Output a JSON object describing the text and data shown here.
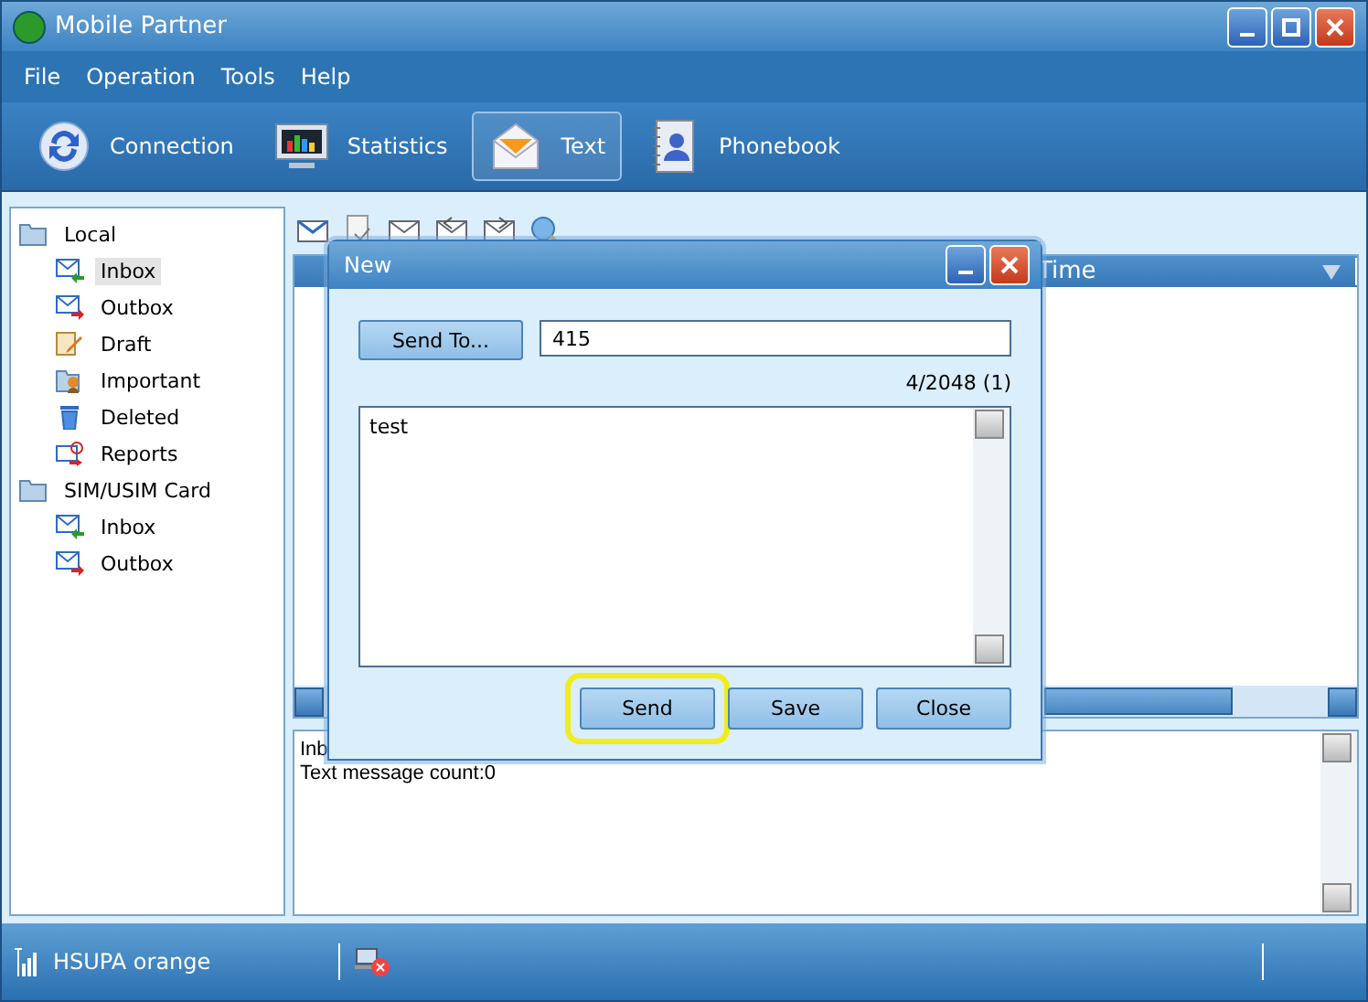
{
  "window": {
    "title": "Mobile Partner"
  },
  "menu": [
    {
      "label": "File"
    },
    {
      "label": "Operation"
    },
    {
      "label": "Tools"
    },
    {
      "label": "Help"
    }
  ],
  "tabs": [
    {
      "label": "Connection",
      "kind": "sync",
      "selected": false
    },
    {
      "label": "Statistics",
      "kind": "monitor",
      "selected": false
    },
    {
      "label": "Text",
      "kind": "envelope",
      "selected": true
    },
    {
      "label": "Phonebook",
      "kind": "contact",
      "selected": false
    }
  ],
  "sidebar": {
    "items": [
      {
        "label": "Local",
        "kind": "folder",
        "selected": false,
        "children": [
          {
            "label": "Inbox",
            "kind": "inbox",
            "selected": true
          },
          {
            "label": "Outbox",
            "kind": "outbox",
            "selected": false
          },
          {
            "label": "Draft",
            "kind": "draft",
            "selected": false
          },
          {
            "label": "Important",
            "kind": "important",
            "selected": false
          },
          {
            "label": "Deleted",
            "kind": "deleted",
            "selected": false
          },
          {
            "label": "Reports",
            "kind": "reports",
            "selected": false
          }
        ]
      },
      {
        "label": "SIM/USIM Card",
        "kind": "folder",
        "selected": false,
        "children": [
          {
            "label": "Inbox",
            "kind": "inbox",
            "selected": false
          },
          {
            "label": "Outbox",
            "kind": "outbox",
            "selected": false
          }
        ]
      }
    ]
  },
  "table": {
    "columns": [
      {
        "label": "Time"
      }
    ]
  },
  "details": {
    "lines": [
      "Inb",
      "Text message count:0"
    ]
  },
  "dialog": {
    "title": "New",
    "send_to_button": "Send To...",
    "recipient": "415",
    "counter": "4/2048 (1)",
    "message": "test",
    "buttons": [
      {
        "label": "Send",
        "highlighted": true
      },
      {
        "label": "Save",
        "highlighted": false
      },
      {
        "label": "Close",
        "highlighted": false
      }
    ]
  },
  "status_bar": {
    "network": "HSUPA orange"
  }
}
